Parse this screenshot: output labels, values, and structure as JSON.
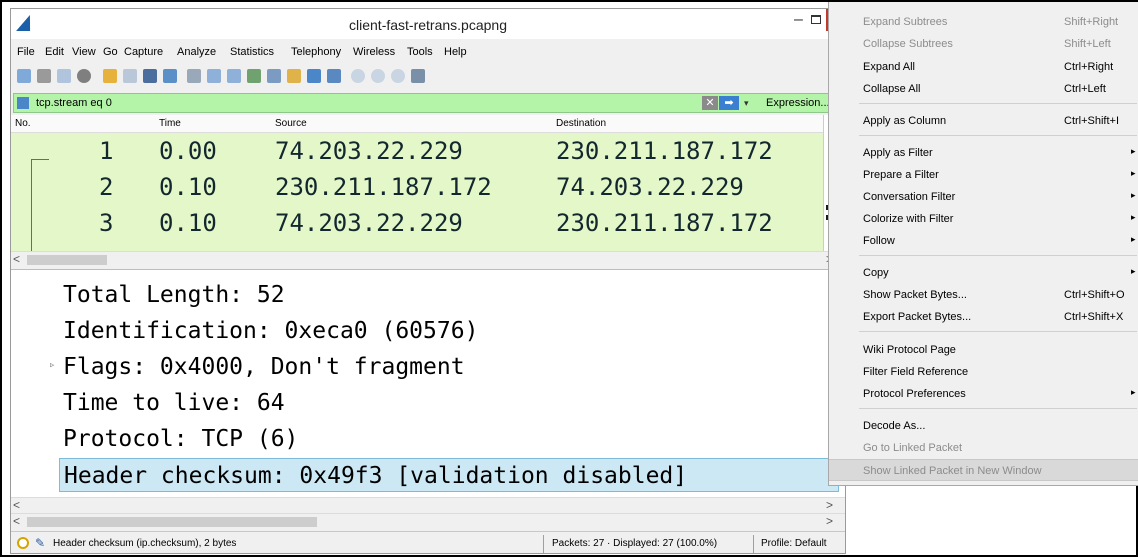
{
  "window": {
    "title": "client-fast-retrans.pcapng",
    "min_glyph": "–"
  },
  "menubar": [
    "File",
    "Edit",
    "View",
    "Go",
    "Capture",
    "Analyze",
    "Statistics",
    "Telephony",
    "Wireless",
    "Tools",
    "Help"
  ],
  "filter": {
    "value": "tcp.stream eq 0",
    "clear_glyph": "✕",
    "apply_glyph": "➡",
    "dropdown_glyph": "▾",
    "expression_label": "Expression..."
  },
  "packet_list": {
    "headers": {
      "no": "No.",
      "time": "Time",
      "source": "Source",
      "destination": "Destination"
    },
    "rows": [
      {
        "no": "1",
        "time": "0.00",
        "source": "74.203.22.229",
        "destination": "230.211.187.172"
      },
      {
        "no": "2",
        "time": "0.10",
        "source": "230.211.187.172",
        "destination": "74.203.22.229"
      },
      {
        "no": "3",
        "time": "0.10",
        "source": "74.203.22.229",
        "destination": "230.211.187.172"
      }
    ],
    "row_color": "#e4f7c9"
  },
  "details": {
    "rows": [
      {
        "text": "Total Length: 52"
      },
      {
        "text": "Identification: 0xeca0 (60576)"
      },
      {
        "text": "Flags: 0x4000, Don't fragment",
        "expander": "▹"
      },
      {
        "text": "Time to live: 64"
      },
      {
        "text": "Protocol: TCP (6)"
      },
      {
        "text": "Header checksum: 0x49f3 [validation disabled]",
        "selected": true
      }
    ]
  },
  "scroll": {
    "left_glyph": "<",
    "right_glyph": ">"
  },
  "statusbar": {
    "field_info": "Header checksum (ip.checksum), 2 bytes",
    "edit_glyph": "✎",
    "packets": "Packets: 27 · Displayed: 27 (100.0%)",
    "profile": "Profile: Default"
  },
  "context_menu": {
    "submenu_glyph": "▸",
    "items": [
      {
        "label": "Expand Subtrees",
        "shortcut": "Shift+Right",
        "disabled": true
      },
      {
        "label": "Collapse Subtrees",
        "shortcut": "Shift+Left",
        "disabled": true
      },
      {
        "label": "Expand All",
        "shortcut": "Ctrl+Right"
      },
      {
        "label": "Collapse All",
        "shortcut": "Ctrl+Left"
      },
      {
        "label": "Apply as Column",
        "shortcut": "Ctrl+Shift+I"
      },
      {
        "label": "Apply as Filter",
        "submenu": true
      },
      {
        "label": "Prepare a Filter",
        "submenu": true
      },
      {
        "label": "Conversation Filter",
        "submenu": true
      },
      {
        "label": "Colorize with Filter",
        "submenu": true
      },
      {
        "label": "Follow",
        "submenu": true
      },
      {
        "label": "Copy",
        "submenu": true
      },
      {
        "label": "Show Packet Bytes...",
        "shortcut": "Ctrl+Shift+O"
      },
      {
        "label": "Export Packet Bytes...",
        "shortcut": "Ctrl+Shift+X"
      },
      {
        "label": "Wiki Protocol Page"
      },
      {
        "label": "Filter Field Reference"
      },
      {
        "label": "Protocol Preferences",
        "submenu": true
      },
      {
        "label": "Decode As..."
      },
      {
        "label": "Go to Linked Packet",
        "disabled": true
      },
      {
        "label": "Show Linked Packet in New Window",
        "disabled": true,
        "highlighted": true
      }
    ]
  },
  "colors": {
    "filter_bg": "#b4f4a8",
    "selected_bg": "#cce8f4",
    "close_button": "#c0392b"
  }
}
